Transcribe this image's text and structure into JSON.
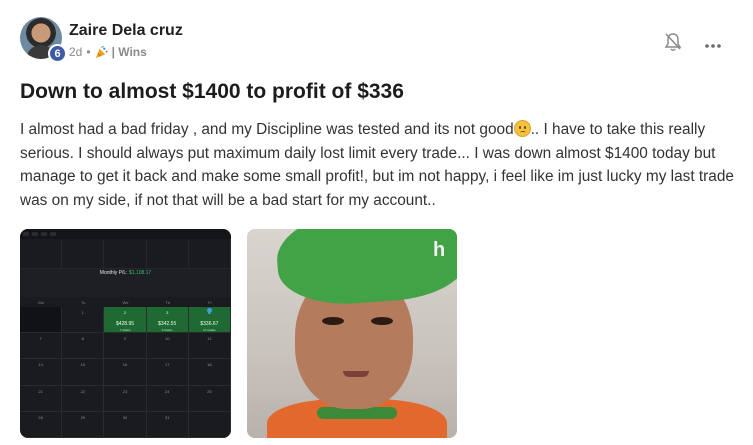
{
  "post": {
    "author": "Zaire Dela cruz",
    "level": "6",
    "time_ago": "2d",
    "separator": "•",
    "category": "| Wins",
    "title": "Down to almost $1400 to profit of $336",
    "body_part1": "I almost had a bad friday , and my Discipline was tested and its not good",
    "body_part2": ".. I have to take this really serious. I should always put maximum daily lost limit every trade... I was down almost $1400 today but manage to get it back and make some small profit!, but im not happy, i feel like im just lucky my last trade was on my side, if not that will be a bad start for my account..",
    "emoji": "sad-face-emoji"
  },
  "icons": {
    "bell": "bell-off-icon",
    "more": "more-horizontal-icon",
    "category": "party-popper-icon"
  },
  "attachments": {
    "calendar": {
      "monthly_label": "Monthly P/L:",
      "monthly_value": "$1,108.17",
      "weekdays": [
        "Mo",
        "Tu",
        "We",
        "Th",
        "Fr"
      ],
      "days": [
        [
          "",
          "1",
          "2",
          "3",
          "4"
        ],
        [
          "7",
          "8",
          "9",
          "10",
          "11"
        ],
        [
          "14",
          "15",
          "16",
          "17",
          "18"
        ],
        [
          "21",
          "22",
          "23",
          "24",
          "25"
        ],
        [
          "28",
          "29",
          "30",
          "31",
          ""
        ]
      ],
      "wins": [
        {
          "amount": "$428.95",
          "trades": "7 trades"
        },
        {
          "amount": "$342.55",
          "trades": "3 trades"
        },
        {
          "amount": "$336.67",
          "trades": "17 trades"
        }
      ]
    },
    "gif_watermark": "h"
  },
  "colors": {
    "accent": "#3d5aa9",
    "win": "#1f6a33",
    "cap_green": "#41a246"
  }
}
